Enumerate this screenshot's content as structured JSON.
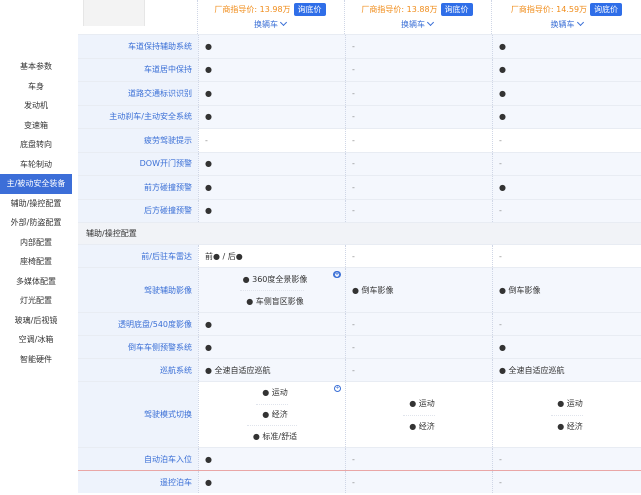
{
  "nav": [
    "基本参数",
    "车身",
    "发动机",
    "变速箱",
    "底盘转向",
    "车轮制动",
    "主/被动安全装备",
    "辅助/操控配置",
    "外部/防盗配置",
    "内部配置",
    "座椅配置",
    "多媒体配置",
    "灯光配置",
    "玻璃/后视镜",
    "空调/冰箱",
    "智能硬件"
  ],
  "nav_active": 6,
  "cars": [
    {
      "price_label": "厂商指导价: 13.98万",
      "ask": "询底价",
      "switch": "换辆车"
    },
    {
      "price_label": "厂商指导价: 13.88万",
      "ask": "询底价",
      "switch": "换辆车"
    },
    {
      "price_label": "厂商指导价: 14.59万",
      "ask": "询底价",
      "switch": "换辆车"
    }
  ],
  "safety_rows": [
    {
      "label": "车道保持辅助系统",
      "v": [
        "●",
        "-",
        "●"
      ]
    },
    {
      "label": "车道居中保持",
      "v": [
        "●",
        "-",
        "●"
      ]
    },
    {
      "label": "道路交通标识识别",
      "v": [
        "●",
        "-",
        "●"
      ]
    },
    {
      "label": "主动刹车/主动安全系统",
      "v": [
        "●",
        "-",
        "●"
      ]
    },
    {
      "label": "疲劳驾驶提示",
      "v": [
        "-",
        "-",
        "-"
      ]
    },
    {
      "label": "DOW开门预警",
      "v": [
        "●",
        "-",
        "-"
      ]
    },
    {
      "label": "前方碰撞预警",
      "v": [
        "●",
        "-",
        "●"
      ]
    },
    {
      "label": "后方碰撞预警",
      "v": [
        "●",
        "-",
        "-"
      ]
    }
  ],
  "section2": "辅助/操控配置",
  "assist": {
    "parking_radar": {
      "label": "前/后驻车雷达",
      "v": [
        "前● / 后●",
        "-",
        "-"
      ]
    },
    "camera": {
      "label": "驾驶辅助影像",
      "c1": [
        "● 360度全景影像",
        "● 车侧盲区影像"
      ],
      "c2": "● 倒车影像",
      "c3": "● 倒车影像"
    },
    "transparent": {
      "label": "透明底盘/540度影像",
      "v": [
        "●",
        "-",
        "-"
      ]
    },
    "reverse_warn": {
      "label": "倒车车侧预警系统",
      "v": [
        "●",
        "-",
        "●"
      ]
    },
    "cruise": {
      "label": "巡航系统",
      "v": [
        "● 全速自适应巡航",
        "-",
        "● 全速自适应巡航"
      ]
    },
    "drive_mode": {
      "label": "驾驶模式切换",
      "c1": [
        "● 运动",
        "● 经济",
        "● 标准/舒适"
      ],
      "c2": [
        "● 运动",
        "● 经济"
      ],
      "c3": [
        "● 运动",
        "● 经济"
      ]
    },
    "auto_park": {
      "label": "自动泊车入位",
      "v": [
        "●",
        "-",
        "-"
      ]
    },
    "remote_park": {
      "label": "遥控泊车",
      "v": [
        "●",
        "-",
        "-"
      ]
    }
  }
}
